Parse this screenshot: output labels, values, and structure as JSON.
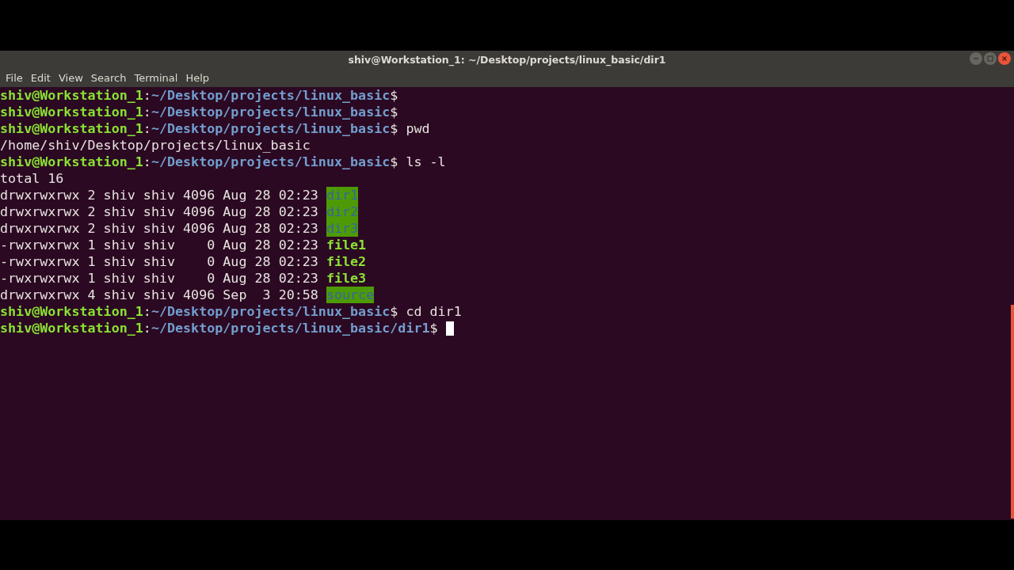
{
  "window": {
    "title": "shiv@Workstation_1: ~/Desktop/projects/linux_basic/dir1"
  },
  "menu": [
    "File",
    "Edit",
    "View",
    "Search",
    "Terminal",
    "Help"
  ],
  "lines": [
    {
      "kind": "prompt",
      "user": "shiv@Workstation_1",
      "sep": ":",
      "path": "~/Desktop/projects/linux_basic",
      "symbol": "$"
    },
    {
      "kind": "prompt",
      "user": "shiv@Workstation_1",
      "sep": ":",
      "path": "~/Desktop/projects/linux_basic",
      "symbol": "$"
    },
    {
      "kind": "prompt",
      "user": "shiv@Workstation_1",
      "sep": ":",
      "path": "~/Desktop/projects/linux_basic",
      "symbol": "$",
      "command": "pwd"
    },
    {
      "kind": "output",
      "text": "/home/shiv/Desktop/projects/linux_basic"
    },
    {
      "kind": "prompt",
      "user": "shiv@Workstation_1",
      "sep": ":",
      "path": "~/Desktop/projects/linux_basic",
      "symbol": "$",
      "command": "ls -l"
    },
    {
      "kind": "output",
      "text": "total 16"
    },
    {
      "kind": "listing",
      "meta": "drwxrwxrwx 2 shiv shiv 4096 Aug 28 02:23",
      "file": {
        "text": "dir1",
        "kind": "dir"
      }
    },
    {
      "kind": "listing",
      "meta": "drwxrwxrwx 2 shiv shiv 4096 Aug 28 02:23",
      "file": {
        "text": "dir2",
        "kind": "dir"
      }
    },
    {
      "kind": "listing",
      "meta": "drwxrwxrwx 2 shiv shiv 4096 Aug 28 02:23",
      "file": {
        "text": "dir3",
        "kind": "dir"
      }
    },
    {
      "kind": "listing",
      "meta": "-rwxrwxrwx 1 shiv shiv    0 Aug 28 02:23",
      "file": {
        "text": "file1",
        "kind": "exec"
      }
    },
    {
      "kind": "listing",
      "meta": "-rwxrwxrwx 1 shiv shiv    0 Aug 28 02:23",
      "file": {
        "text": "file2",
        "kind": "exec"
      }
    },
    {
      "kind": "listing",
      "meta": "-rwxrwxrwx 1 shiv shiv    0 Aug 28 02:23",
      "file": {
        "text": "file3",
        "kind": "exec"
      }
    },
    {
      "kind": "listing",
      "meta": "drwxrwxrwx 4 shiv shiv 4096 Sep  3 20:58",
      "file": {
        "text": "source",
        "kind": "dir"
      }
    },
    {
      "kind": "prompt",
      "user": "shiv@Workstation_1",
      "sep": ":",
      "path": "~/Desktop/projects/linux_basic",
      "symbol": "$",
      "command": "cd dir1"
    },
    {
      "kind": "prompt",
      "user": "shiv@Workstation_1",
      "sep": ":",
      "path": "~/Desktop/projects/linux_basic/dir1",
      "symbol": "$",
      "cursor": true
    }
  ]
}
